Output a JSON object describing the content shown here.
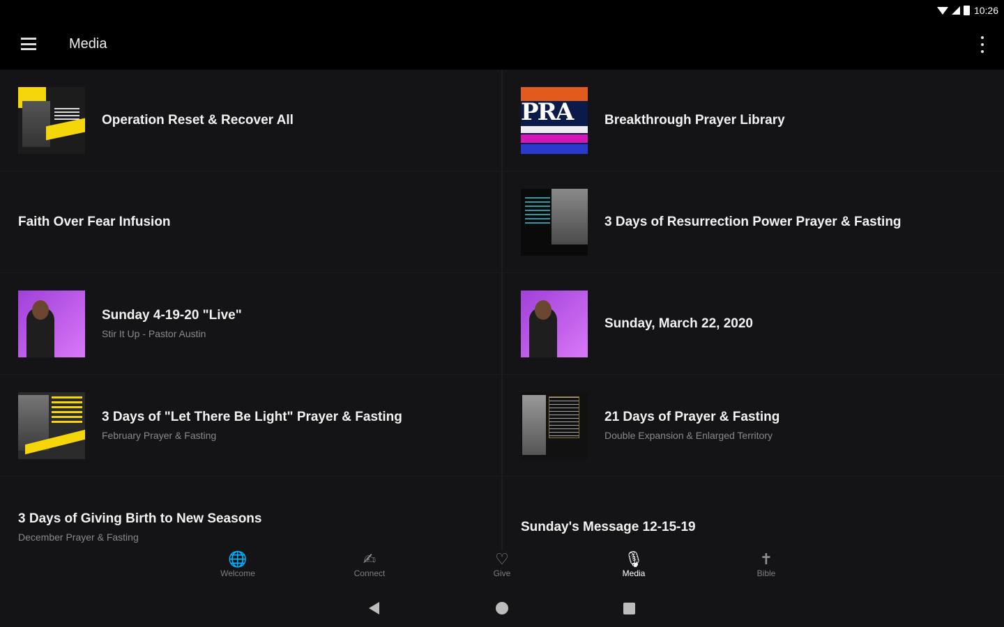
{
  "status": {
    "time": "10:26"
  },
  "appbar": {
    "title": "Media"
  },
  "left_items": [
    {
      "title": "Operation Reset & Recover All",
      "subtitle": ""
    },
    {
      "title": "Faith Over Fear Infusion",
      "subtitle": ""
    },
    {
      "title": "Sunday 4-19-20 \"Live\"",
      "subtitle": "Stir It Up - Pastor Austin"
    },
    {
      "title": "3 Days of \"Let There Be Light\" Prayer & Fasting",
      "subtitle": "February Prayer & Fasting"
    },
    {
      "title": "3 Days of Giving Birth to New Seasons",
      "subtitle": "December Prayer & Fasting"
    }
  ],
  "right_items": [
    {
      "title": "Breakthrough Prayer Library",
      "subtitle": ""
    },
    {
      "title": "3 Days of Resurrection Power Prayer & Fasting",
      "subtitle": ""
    },
    {
      "title": "Sunday, March 22, 2020",
      "subtitle": ""
    },
    {
      "title": "21 Days of Prayer & Fasting",
      "subtitle": "Double Expansion & Enlarged Territory"
    },
    {
      "title": "Sunday's Message 12-15-19",
      "subtitle": ""
    }
  ],
  "bottom_nav": [
    {
      "label": "Welcome",
      "icon": "globe-icon",
      "glyph": "🌐"
    },
    {
      "label": "Connect",
      "icon": "handshake-icon",
      "glyph": "✍"
    },
    {
      "label": "Give",
      "icon": "heart-icon",
      "glyph": "♡"
    },
    {
      "label": "Media",
      "icon": "microphone-icon",
      "glyph": "🎙"
    },
    {
      "label": "Bible",
      "icon": "cross-icon",
      "glyph": "✝"
    }
  ],
  "colors": {
    "background": "#141416",
    "bar": "#000000",
    "text": "#f2f2f2",
    "subtext": "#8a8a8a"
  }
}
